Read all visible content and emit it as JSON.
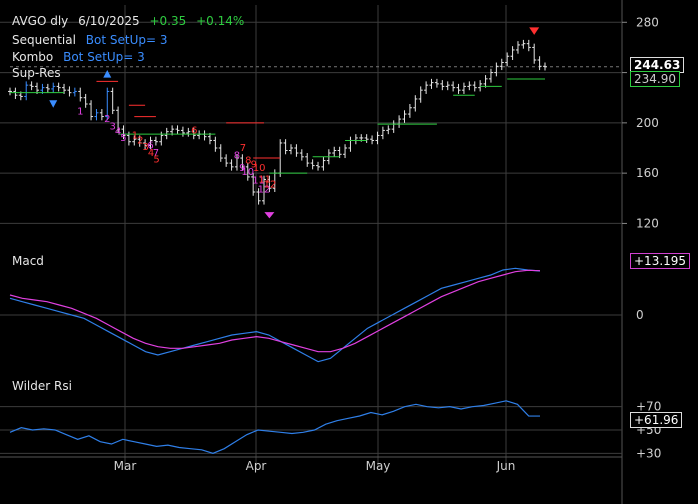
{
  "header": {
    "symbol": "AVGO dly",
    "date": "6/10/2025",
    "change": "+0.35",
    "change_pct": "+0.14%",
    "row2_name": "Sequential",
    "row2_value": "Bot SetUp=  3",
    "row3_name": "Kombo",
    "row3_value": "Bot SetUp=  3",
    "row4_name": "Sup-Res"
  },
  "colors": {
    "background": "#000000",
    "grid": "#3c3c3c",
    "price_bar": "#e6e6e6",
    "rising_bar": "#3a8dff",
    "resistance": "#ff3030",
    "support": "#2ecc40",
    "macd_line": "#2f7fe8",
    "signal_line": "#e040e0",
    "rsi_line": "#2f7fe8",
    "seq_count": "#e040e0",
    "kombo_count": "#ff3030",
    "up_arrow": "#3a8dff"
  },
  "price_panel": {
    "yticks": [
      "280",
      "240",
      "200",
      "160",
      "120"
    ],
    "last_price": "244.63",
    "last_support": "234.90"
  },
  "macd_panel": {
    "title": "Macd",
    "yticks": [
      "0"
    ],
    "last_value": "+13.195"
  },
  "rsi_panel": {
    "title": "Wilder Rsi",
    "yticks": [
      "+70",
      "+50",
      "+30"
    ],
    "last_value": "+61.96"
  },
  "x_axis": {
    "labels": [
      "Mar",
      "Apr",
      "May",
      "Jun"
    ]
  },
  "chart_data": {
    "type": "line",
    "title": "AVGO dly",
    "price": {
      "ylim": [
        110,
        285
      ],
      "closes": [
        225,
        222,
        221,
        230,
        229,
        226,
        228,
        227,
        229,
        228,
        226,
        224,
        225,
        220,
        215,
        205,
        208,
        205,
        225,
        210,
        195,
        190,
        185,
        187,
        184,
        182,
        186,
        185,
        190,
        193,
        195,
        194,
        192,
        193,
        190,
        191,
        189,
        186,
        180,
        172,
        168,
        165,
        172,
        165,
        157,
        145,
        138,
        155,
        148,
        160,
        184,
        178,
        180,
        176,
        173,
        168,
        166,
        165,
        170,
        176,
        178,
        175,
        180,
        186,
        188,
        188,
        187,
        186,
        190,
        194,
        195,
        199,
        203,
        207,
        212,
        219,
        226,
        230,
        232,
        231,
        229,
        230,
        228,
        226,
        229,
        230,
        228,
        231,
        235,
        240,
        245,
        248,
        253,
        258,
        262,
        263,
        260,
        250,
        245,
        244.63
      ],
      "sequential_labels": [
        "1",
        "2",
        "3",
        "4",
        "5",
        "6",
        "7",
        "8",
        "9",
        "10",
        "11",
        "12"
      ],
      "kombo_labels": [
        "1",
        "2",
        "3",
        "4",
        "5",
        "6",
        "7",
        "8",
        "9",
        "10",
        "11",
        "12"
      ]
    },
    "macd": {
      "macd": [
        5,
        4,
        3,
        2,
        1,
        0,
        -1,
        -3,
        -5,
        -7,
        -9,
        -11,
        -12,
        -11,
        -10,
        -9,
        -8,
        -7,
        -6,
        -5.5,
        -5,
        -6,
        -8,
        -10,
        -12,
        -14,
        -13,
        -10,
        -7,
        -4,
        -2,
        0,
        2,
        4,
        6,
        8,
        9,
        10,
        11,
        12,
        13.5,
        14,
        13.5,
        13.195
      ],
      "signal": [
        6,
        5,
        4.5,
        4,
        3,
        2,
        0.5,
        -1,
        -3,
        -5,
        -7,
        -8.5,
        -9.5,
        -10,
        -10,
        -9.5,
        -9,
        -8.5,
        -7.5,
        -7,
        -6.5,
        -7,
        -8,
        -9,
        -10,
        -11,
        -11,
        -10,
        -8.5,
        -6.5,
        -4.5,
        -2.5,
        -0.5,
        1.5,
        3.5,
        5.5,
        7,
        8.5,
        10,
        11,
        12,
        13,
        13.4,
        13.3
      ]
    },
    "rsi": {
      "ylim": [
        20,
        80
      ],
      "values": [
        48,
        52,
        50,
        51,
        50,
        46,
        42,
        45,
        40,
        38,
        42,
        40,
        38,
        36,
        37,
        35,
        34,
        33,
        30,
        34,
        40,
        46,
        50,
        49,
        48,
        47,
        48,
        50,
        55,
        58,
        60,
        62,
        65,
        63,
        66,
        70,
        72,
        70,
        69,
        70,
        68,
        70,
        71,
        73,
        75,
        72,
        62,
        61.96
      ]
    }
  }
}
